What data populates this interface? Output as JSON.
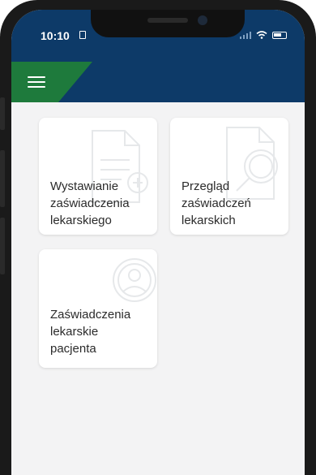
{
  "status_bar": {
    "time": "10:10"
  },
  "colors": {
    "header": "#0d3a68",
    "accent": "#1e7a3c",
    "background": "#f3f3f4"
  },
  "tiles": [
    {
      "label": "Wystawianie\nzaświadczenia\nlekarskiego",
      "icon": "document-add-icon"
    },
    {
      "label": "Przegląd\nzaświadczeń\nlekarskich",
      "icon": "document-search-icon"
    },
    {
      "label": "Zaświadczenia\nlekarskie\npacjenta",
      "icon": "patient-icon"
    }
  ]
}
